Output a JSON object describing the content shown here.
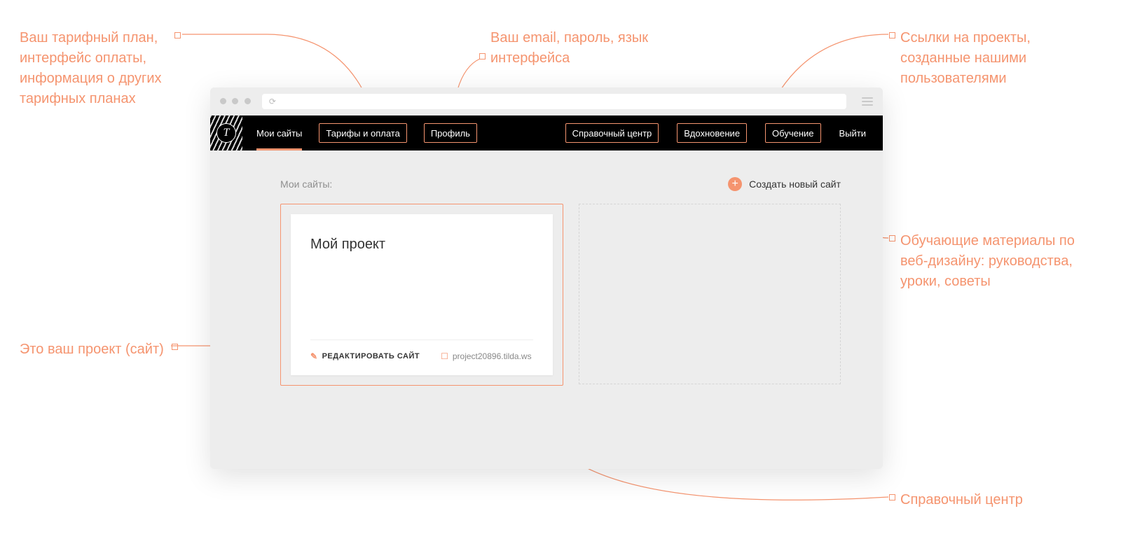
{
  "annotations": {
    "tariff": "Ваш тарифный план, интерфейс оплаты, информация о других тарифных планах",
    "profile": "Ваш email, пароль, язык интерфейса",
    "inspiration": "Ссылки на проекты, созданные нашими пользователями",
    "learning": "Обучающие материалы по веб-дизайну: руководства, уроки, советы",
    "help": "Справочный центр",
    "project": "Это ваш проект (сайт)"
  },
  "nav": {
    "my_sites": "Мои сайты",
    "tariffs": "Тарифы и оплата",
    "profile": "Профиль",
    "help_center": "Справочный центр",
    "inspiration": "Вдохновение",
    "learning": "Обучение",
    "logout": "Выйти",
    "logo_letter": "T"
  },
  "body": {
    "heading": "Мои сайты:",
    "create_site": "Создать новый сайт"
  },
  "project": {
    "title": "Мой проект",
    "edit_label": "РЕДАКТИРОВАТЬ САЙТ",
    "url": "project20896.tilda.ws"
  }
}
